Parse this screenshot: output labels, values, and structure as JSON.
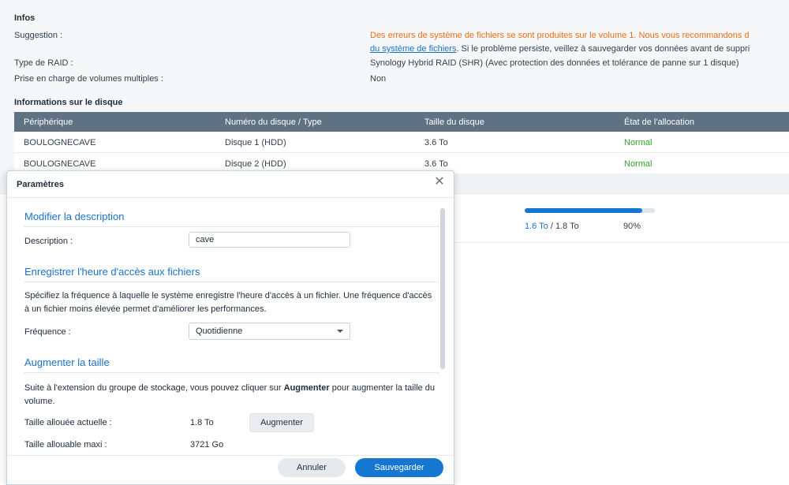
{
  "background": {
    "infos_title": "Infos",
    "rows": [
      {
        "label": "Suggestion :",
        "value_line1": "Des erreurs de système de fichiers se sont produites sur le volume 1. Nous vous recommandons d",
        "value_line2_link": "du système de fichiers",
        "value_line2_rest": ". Si le problème persiste, veillez à sauvegarder vos données avant de suppri"
      },
      {
        "label": "Type de RAID :",
        "value": "Synology Hybrid RAID (SHR) (Avec protection des données et tolérance de panne sur 1 disque)"
      },
      {
        "label": "Prise en charge de volumes multiples :",
        "value": "Non"
      }
    ],
    "disk_section_title": "Informations sur le disque",
    "table": {
      "headers": [
        "Périphérique",
        "Numéro du disque / Type",
        "Taille du disque",
        "État de l'allocation"
      ],
      "rows": [
        [
          "BOULOGNECAVE",
          "Disque 1 (HDD)",
          "3.6 To",
          "Normal"
        ],
        [
          "BOULOGNECAVE",
          "Disque 2 (HDD)",
          "3.6 To",
          "Normal"
        ]
      ]
    },
    "usage": {
      "used": "1.6 To",
      "separator": " / ",
      "total": "1.8 To",
      "percent_label": "90%",
      "fill_fraction": 0.9
    }
  },
  "dialog": {
    "title": "Paramètres",
    "sections": {
      "description": {
        "heading": "Modifier la description",
        "label": "Description :",
        "value": "cave"
      },
      "access_time": {
        "heading": "Enregistrer l'heure d'accès aux fichiers",
        "text": "Spécifiez la fréquence à laquelle le système enregistre l'heure d'accès à un fichier. Une fréquence d'accès à un fichier moins élevée permet d'améliorer les performances.",
        "label": "Fréquence :",
        "selected": "Quotidienne"
      },
      "resize": {
        "heading": "Augmenter la taille",
        "text_before": "Suite à l'extension du groupe de stockage, vous pouvez cliquer sur ",
        "text_bold": "Augmenter",
        "text_after": " pour augmenter la taille du volume.",
        "current_label": "Taille allouée actuelle :",
        "current_value": "1.8 To",
        "button": "Augmenter",
        "max_label": "Taille allouable maxi :",
        "max_value": "3721 Go"
      }
    },
    "footer": {
      "cancel": "Annuler",
      "save": "Sauvegarder"
    }
  },
  "colors": {
    "accent": "#1677d2",
    "warning": "#e8701a",
    "ok": "#32a02c",
    "table_header": "#5f7283"
  }
}
